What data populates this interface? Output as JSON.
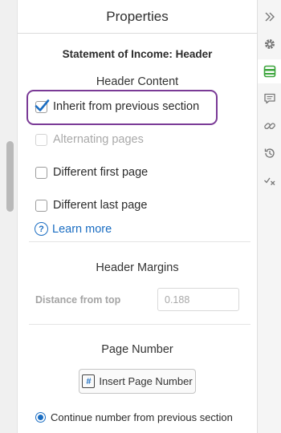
{
  "panel": {
    "title": "Properties",
    "section_title": "Statement of Income: Header"
  },
  "header_content": {
    "title": "Header Content",
    "options": [
      {
        "label": "Inherit from previous section",
        "checked": true,
        "disabled": false
      },
      {
        "label": "Alternating pages",
        "checked": false,
        "disabled": true
      },
      {
        "label": "Different first page",
        "checked": false,
        "disabled": false
      },
      {
        "label": "Different last page",
        "checked": false,
        "disabled": false
      }
    ],
    "learn_more": "Learn more",
    "help_glyph": "?"
  },
  "header_margins": {
    "title": "Header Margins",
    "distance_label": "Distance from top",
    "distance_value": "0.188"
  },
  "page_number": {
    "title": "Page Number",
    "insert_label": "Insert Page Number",
    "insert_glyph": "#",
    "continue_label": "Continue number from previous section",
    "continue_selected": true
  },
  "rail": {
    "items": [
      "collapse-icon",
      "gear-icon",
      "header-footer-icon",
      "comment-icon",
      "link-icon",
      "history-icon",
      "check-x-icon"
    ],
    "active": "header-footer-icon"
  },
  "colors": {
    "accent": "#1a6dc2",
    "highlight": "#7a3a96",
    "active_icon": "#3aa43a"
  }
}
